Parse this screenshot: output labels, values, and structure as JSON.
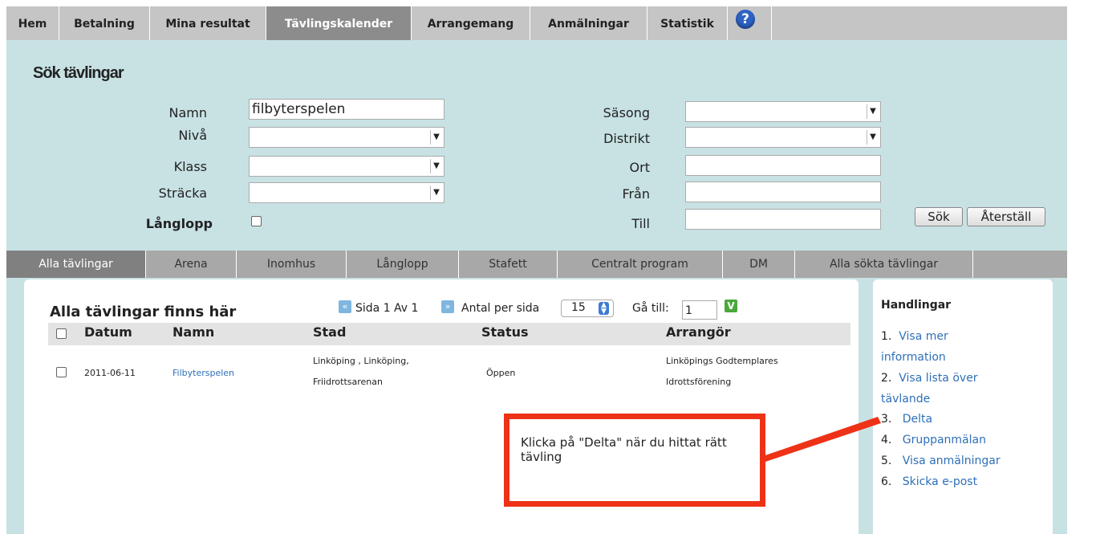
{
  "topnav": {
    "tabs": [
      "Hem",
      "Betalning",
      "Mina resultat",
      "Tävlingskalender",
      "Arrangemang",
      "Anmälningar",
      "Statistik"
    ],
    "help_icon": "help-icon"
  },
  "search": {
    "title": "Sök tävlingar",
    "labels": {
      "namn": "Namn",
      "niva": "Nivå",
      "klass": "Klass",
      "stracka": "Sträcka",
      "langlopp": "Långlopp",
      "sasong": "Säsong",
      "distrikt": "Distrikt",
      "ort": "Ort",
      "fran": "Från",
      "till": "Till"
    },
    "values": {
      "namn": "filbyterspelen"
    },
    "buttons": {
      "search": "Sök",
      "reset": "Återställ"
    }
  },
  "subtabs": [
    "Alla tävlingar",
    "Arena",
    "Inomhus",
    "Långlopp",
    "Stafett",
    "Centralt program",
    "DM",
    "Alla sökta tävlingar"
  ],
  "list": {
    "title": "Alla tävlingar finns här",
    "pager": {
      "page_text": "Sida 1 Av 1",
      "per_page_label": "Antal per sida",
      "per_page_value": "15",
      "goto_label": "Gå till:",
      "goto_value": "1"
    },
    "columns": [
      "Datum",
      "Namn",
      "Stad",
      "Status",
      "Arrangör"
    ],
    "rows": [
      {
        "datum": "2011-06-11",
        "namn": "Filbyterspelen",
        "stad_line1": "Linköping , Linköping,",
        "stad_line2": "Friidrottsarenan",
        "status": "Öppen",
        "arrangor_line1": "Linköpings Godtemplares",
        "arrangor_line2": "Idrottsförening"
      }
    ]
  },
  "sidebar": {
    "title": "Handlingar",
    "actions": [
      {
        "n": "1.",
        "line1": "Visa mer",
        "line2": "information"
      },
      {
        "n": "2.",
        "line1": "Visa lista över",
        "line2": "tävlande"
      },
      {
        "n": "3.",
        "line1": "Delta"
      },
      {
        "n": "4.",
        "line1": "Gruppanmälan"
      },
      {
        "n": "5.",
        "line1": "Visa anmälningar"
      },
      {
        "n": "6.",
        "line1": "Skicka e-post"
      }
    ]
  },
  "callout": {
    "text": "Klicka på \"Delta\" när du hittat rätt tävling",
    "color": "#ee3218"
  }
}
